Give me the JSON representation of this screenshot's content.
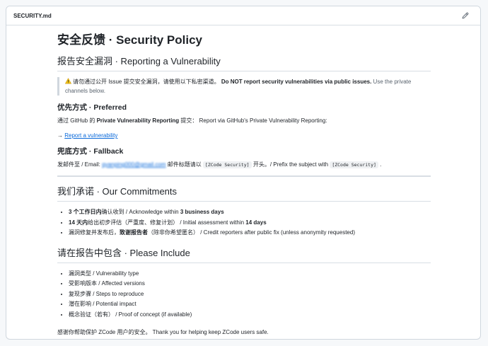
{
  "file": {
    "name": "SECURITY.md"
  },
  "doc": {
    "title": "安全反馈 · Security Policy",
    "reporting": {
      "heading": "报告安全漏洞 · Reporting a Vulnerability",
      "note_cn": "请勿通过公开 Issue 提交安全漏洞，请使用以下私密渠道。",
      "note_en_bold": "Do NOT report security vulnerabilities via public issues.",
      "note_en_rest": " Use the private channels below."
    },
    "preferred": {
      "heading": "优先方式 · Preferred",
      "text_pre": "通过 GitHub 的 ",
      "text_bold": "Private Vulnerability Reporting",
      "text_post": " 提交： Report via GitHub's Private Vulnerability Reporting:",
      "arrow": "→ ",
      "link": "Report a vulnerability"
    },
    "fallback": {
      "heading": "兜底方式 · Fallback",
      "pre": "发邮件至 / Email: ",
      "email": "qyanping000@gmail.com",
      "mid": " 邮件标题请以 ",
      "code1": "[ZCode Security]",
      "mid2": " 开头。/ Prefix the subject with ",
      "code2": "[ZCode Security]",
      "end": " ."
    },
    "commitments": {
      "heading": "我们承诺 · Our Commitments",
      "items": [
        {
          "bold": "3 个工作日内",
          "text": "确认收到 / Acknowledge within ",
          "bold2": "3 business days",
          "rest": ""
        },
        {
          "bold": "14 天内",
          "text": "给出初步评估（严重度、修复计划） / Initial assessment within ",
          "bold2": "14 days",
          "rest": ""
        },
        {
          "bold": "",
          "text": "漏洞修复并发布后，",
          "bold2": "致谢报告者",
          "rest": "（除非你希望匿名） / Credit reporters after public fix (unless anonymity requested)"
        }
      ]
    },
    "include": {
      "heading": "请在报告中包含 · Please Include",
      "items": [
        "漏洞类型 / Vulnerability type",
        "受影响版本 / Affected versions",
        "复现步骤 / Steps to reproduce",
        "潜在影响 / Potential impact",
        "概念验证（若有） / Proof of concept (if available)"
      ]
    },
    "thanks": "感谢你帮助保护 ZCode 用户的安全。 Thank you for helping keep ZCode users safe."
  },
  "colors": {
    "link": "#0969da",
    "border": "#d0d7de",
    "text": "#1f2328"
  },
  "icons": {
    "edit": "pencil-icon",
    "warning": "warning-icon"
  }
}
